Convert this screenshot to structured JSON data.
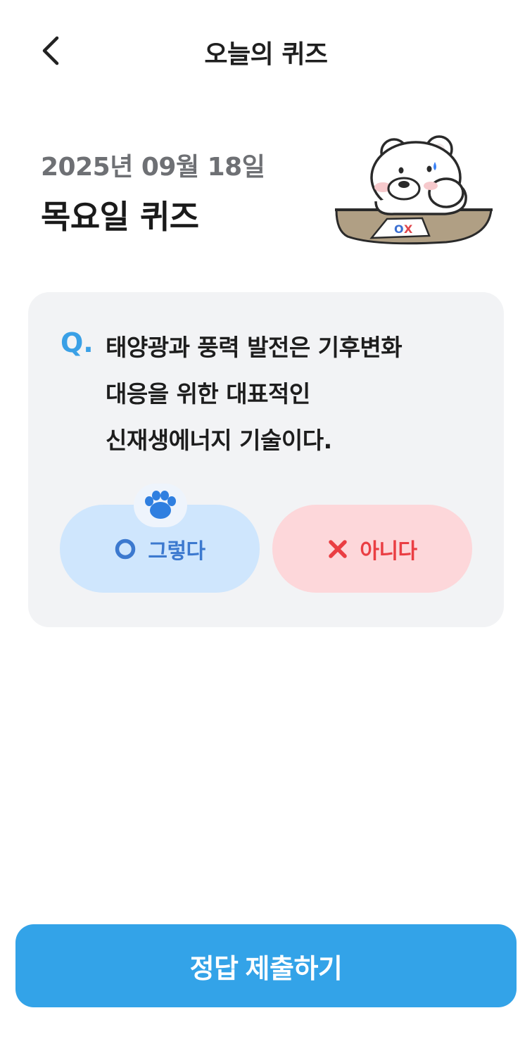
{
  "header": {
    "title": "오늘의 퀴즈",
    "back_icon": "chevron-left-icon"
  },
  "quiz": {
    "date": "2025년 09월 18일",
    "title": "목요일 퀴즈",
    "question_marker": "Q.",
    "question_lines": [
      "태양광과 풍력 발전은 기후변화",
      "대응을 위한 대표적인",
      "신재생에너지 기술이다."
    ]
  },
  "answers": {
    "yes": {
      "label": "그렇다",
      "icon": "circle-o-icon",
      "color": "#3c79cf",
      "bg": "#cfe6fd"
    },
    "no": {
      "label": "아니다",
      "icon": "x-icon",
      "color": "#ea3e43",
      "bg": "#fdd7da"
    },
    "paw_icon": "paw-icon"
  },
  "submit": {
    "label": "정답 제출하기",
    "color": "#33a3e8"
  },
  "illustration": {
    "sheet_text": "OX"
  }
}
